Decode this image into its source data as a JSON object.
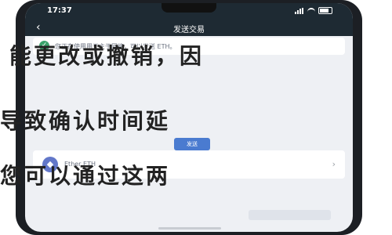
{
  "status_bar": {
    "time": "17:37"
  },
  "header": {
    "title": "发送交易"
  },
  "info_banner": {
    "text": "您正在使用用于主于网络，可以发送 ETH。"
  },
  "asset": {
    "label": "Ether ETH"
  },
  "confirm_label": "发送",
  "overlay_lines": [
    "能更改或撤销，因",
    "导致确认时间延",
    "您可以通过这两"
  ]
}
